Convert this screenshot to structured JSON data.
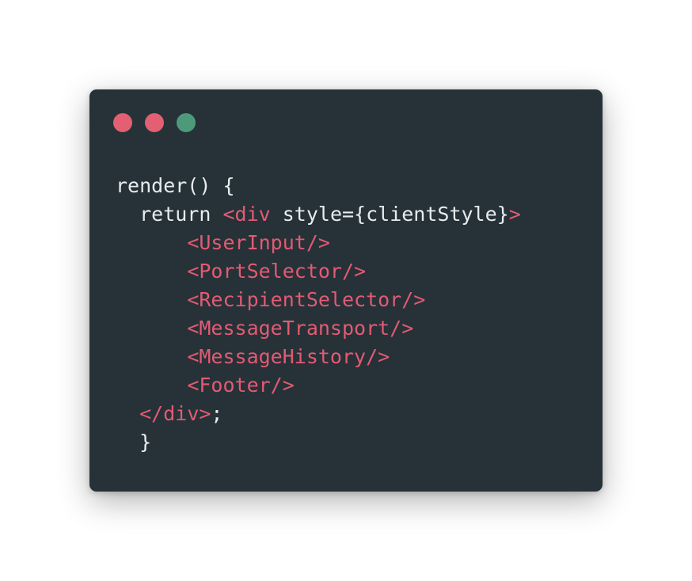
{
  "window": {
    "controls": [
      {
        "name": "close",
        "color": "#e35f72"
      },
      {
        "name": "minimize",
        "color": "#e35f72"
      },
      {
        "name": "zoom",
        "color": "#4d9a7b"
      }
    ]
  },
  "code": {
    "plain_color": "#e7ecef",
    "tag_color": "#e35a73",
    "lines": [
      {
        "indent": "",
        "segments": [
          {
            "text": "render() {",
            "kind": "plain"
          }
        ]
      },
      {
        "indent": "  ",
        "segments": [
          {
            "text": "return ",
            "kind": "plain"
          },
          {
            "text": "<div",
            "kind": "tag"
          },
          {
            "text": " style={clientStyle}",
            "kind": "plain"
          },
          {
            "text": ">",
            "kind": "tag"
          }
        ]
      },
      {
        "indent": "      ",
        "segments": [
          {
            "text": "<UserInput/>",
            "kind": "tag"
          }
        ]
      },
      {
        "indent": "      ",
        "segments": [
          {
            "text": "<PortSelector/>",
            "kind": "tag"
          }
        ]
      },
      {
        "indent": "      ",
        "segments": [
          {
            "text": "<RecipientSelector/>",
            "kind": "tag"
          }
        ]
      },
      {
        "indent": "      ",
        "segments": [
          {
            "text": "<MessageTransport/>",
            "kind": "tag"
          }
        ]
      },
      {
        "indent": "      ",
        "segments": [
          {
            "text": "<MessageHistory/>",
            "kind": "tag"
          }
        ]
      },
      {
        "indent": "      ",
        "segments": [
          {
            "text": "<Footer/>",
            "kind": "tag"
          }
        ]
      },
      {
        "indent": "  ",
        "segments": [
          {
            "text": "</div>",
            "kind": "tag"
          },
          {
            "text": ";",
            "kind": "plain"
          }
        ]
      },
      {
        "indent": "  ",
        "segments": [
          {
            "text": "}",
            "kind": "plain"
          }
        ]
      }
    ]
  }
}
